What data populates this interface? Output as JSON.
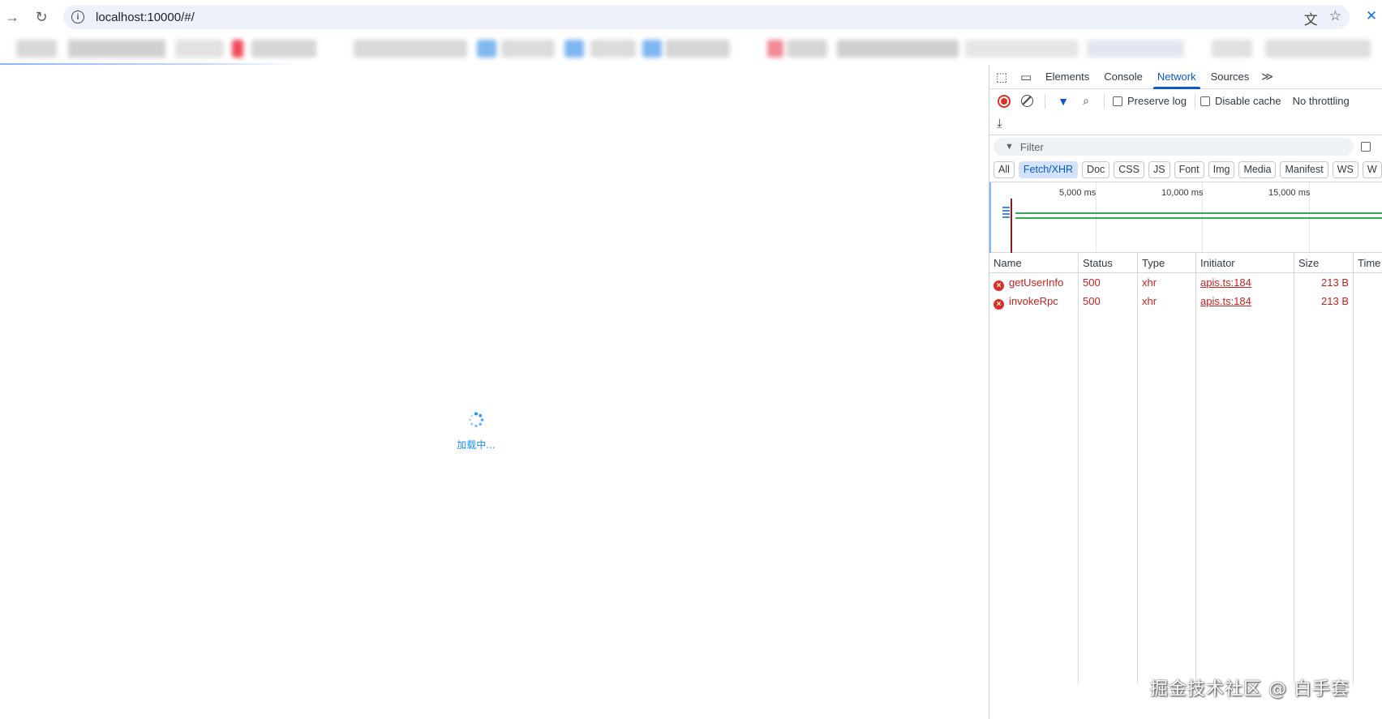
{
  "browser": {
    "url": "localhost:10000/#/",
    "forward_icon": "arrow-right-icon",
    "reload_icon": "reload-icon",
    "info_icon": "info-icon",
    "translate_icon": "translate-icon",
    "bookmark_icon": "star-icon"
  },
  "page": {
    "loading_text": "加载中...",
    "accent": "#1890ff"
  },
  "devtools": {
    "tabs": [
      "Elements",
      "Console",
      "Network",
      "Sources"
    ],
    "active_tab": "Network",
    "toolbar": {
      "preserve_log": "Preserve log",
      "disable_cache": "Disable cache",
      "throttling": "No throttling"
    },
    "filter": {
      "placeholder": "Filter"
    },
    "types": [
      "All",
      "Fetch/XHR",
      "Doc",
      "CSS",
      "JS",
      "Font",
      "Img",
      "Media",
      "Manifest",
      "WS"
    ],
    "active_type": "Fetch/XHR",
    "timeline": {
      "ticks": [
        "5,000 ms",
        "10,000 ms",
        "15,000 ms"
      ]
    },
    "columns": [
      "Name",
      "Status",
      "Type",
      "Initiator",
      "Size",
      "Time"
    ],
    "requests": [
      {
        "name": "getUserInfo",
        "status": "500",
        "type": "xhr",
        "initiator": "apis.ts:184",
        "size": "213 B"
      },
      {
        "name": "invokeRpc",
        "status": "500",
        "type": "xhr",
        "initiator": "apis.ts:184",
        "size": "213 B"
      }
    ],
    "error_color": "#c5221f"
  },
  "watermark": "掘金技术社区 @ 白手套"
}
